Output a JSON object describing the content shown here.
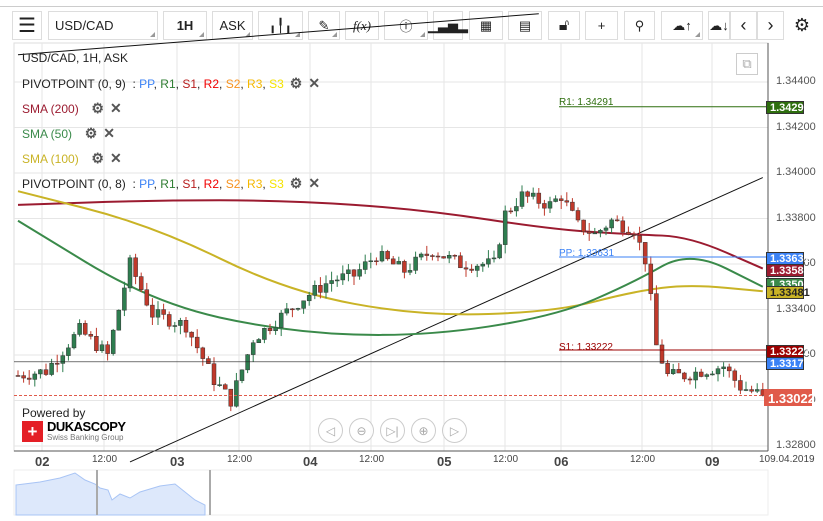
{
  "toolbar": {
    "symbol": "USD/CAD",
    "timeframe": "1H",
    "side": "ASK",
    "fx_label": "f(x)"
  },
  "legend": {
    "title": "USD/CAD, 1H, ASK",
    "pivot1": "PIVOTPOINT (0, 9)",
    "pivot2": "PIVOTPOINT (0, 8)",
    "pivot_parts": [
      {
        "t": "PP",
        "c": "#3b82f6"
      },
      {
        "t": "R1",
        "c": "#2e7d32"
      },
      {
        "t": "S1",
        "c": "#b71c1c"
      },
      {
        "t": "R2",
        "c": "#f00000"
      },
      {
        "t": "S2",
        "c": "#f7921e"
      },
      {
        "t": "R3",
        "c": "#f5b800"
      },
      {
        "t": "S3",
        "c": "#f5e400"
      }
    ],
    "sma200": "SMA (200)",
    "sma50": "SMA (50)",
    "sma100": "SMA (100)"
  },
  "colors": {
    "sma200": "#9b1b30",
    "sma50": "#3a8a4a",
    "sma100": "#c9b326",
    "up": "#2e7d4f",
    "down": "#c0392b",
    "r1": "#2e6e0e",
    "pp": "#3b82f6",
    "s1": "#9b0000"
  },
  "pivots": {
    "r1": "R1: 1.34291",
    "pp": "PP: 1.33631",
    "s1": "S1: 1.33222"
  },
  "badges": {
    "r1": "1.34291",
    "pp": "1.33631",
    "sma200": "1.33580",
    "sma50": "1.33505",
    "sma100": "1.33481",
    "s1": "1.33222",
    "blue": "1.33170",
    "last": "1.33022"
  },
  "footer": {
    "powered": "Powered by",
    "brand": "DUKASCOPY",
    "tagline": "Swiss Banking Group"
  },
  "chart_data": {
    "type": "candlestick",
    "symbol": "USD/CAD",
    "timeframe": "1H",
    "ylim": [
      1.3275,
      1.3455
    ],
    "yticks": [
      "1.34400",
      "1.34200",
      "1.34000",
      "1.33800",
      "1.33600",
      "1.33400",
      "1.33200",
      "1.33000",
      "1.32800"
    ],
    "xticks": [
      {
        "t": "02",
        "d": 1
      },
      {
        "t": "12:00"
      },
      {
        "t": "03",
        "d": 1
      },
      {
        "t": "12:00"
      },
      {
        "t": "04",
        "d": 1
      },
      {
        "t": "12:00"
      },
      {
        "t": "05",
        "d": 1
      },
      {
        "t": "12:00"
      },
      {
        "t": "06",
        "d": 1
      },
      {
        "t": "12:00"
      },
      {
        "t": "09",
        "d": 1
      },
      {
        "t": "109.04.2019"
      }
    ],
    "close_anchors": [
      [
        0,
        1.3311
      ],
      [
        5,
        1.3313
      ],
      [
        11,
        1.3331
      ],
      [
        16,
        1.332
      ],
      [
        20,
        1.336
      ],
      [
        24,
        1.3338
      ],
      [
        30,
        1.3333
      ],
      [
        35,
        1.3309
      ],
      [
        38,
        1.33
      ],
      [
        42,
        1.3327
      ],
      [
        46,
        1.3335
      ],
      [
        51,
        1.3345
      ],
      [
        56,
        1.3353
      ],
      [
        60,
        1.3355
      ],
      [
        64,
        1.3364
      ],
      [
        69,
        1.3357
      ],
      [
        74,
        1.3366
      ],
      [
        79,
        1.336
      ],
      [
        85,
        1.336
      ],
      [
        87,
        1.3382
      ],
      [
        90,
        1.339
      ],
      [
        95,
        1.3386
      ],
      [
        97,
        1.339
      ],
      [
        100,
        1.3377
      ],
      [
        103,
        1.3373
      ],
      [
        106,
        1.3379
      ],
      [
        110,
        1.3375
      ],
      [
        112,
        1.3362
      ],
      [
        113,
        1.3344
      ],
      [
        114,
        1.3324
      ],
      [
        116,
        1.3311
      ],
      [
        119,
        1.3311
      ],
      [
        122,
        1.3313
      ],
      [
        126,
        1.3315
      ],
      [
        129,
        1.3306
      ],
      [
        133,
        1.33022
      ]
    ],
    "sma200": [
      1.3386,
      1.3388,
      1.3388,
      1.3384,
      1.3375,
      1.3373,
      1.3372,
      1.3358
    ],
    "sma100": [
      1.3392,
      1.3377,
      1.3348,
      1.3337,
      1.3339,
      1.3348,
      1.3351,
      1.3348
    ],
    "sma50": [
      1.3379,
      1.3343,
      1.333,
      1.3328,
      1.3337,
      1.3352,
      1.3366,
      1.335
    ],
    "trendlines": [
      [
        [
          0,
          1.3452
        ],
        [
          93,
          1.347
        ]
      ],
      [
        [
          20,
          1.3273
        ],
        [
          133,
          1.3398
        ]
      ]
    ]
  }
}
